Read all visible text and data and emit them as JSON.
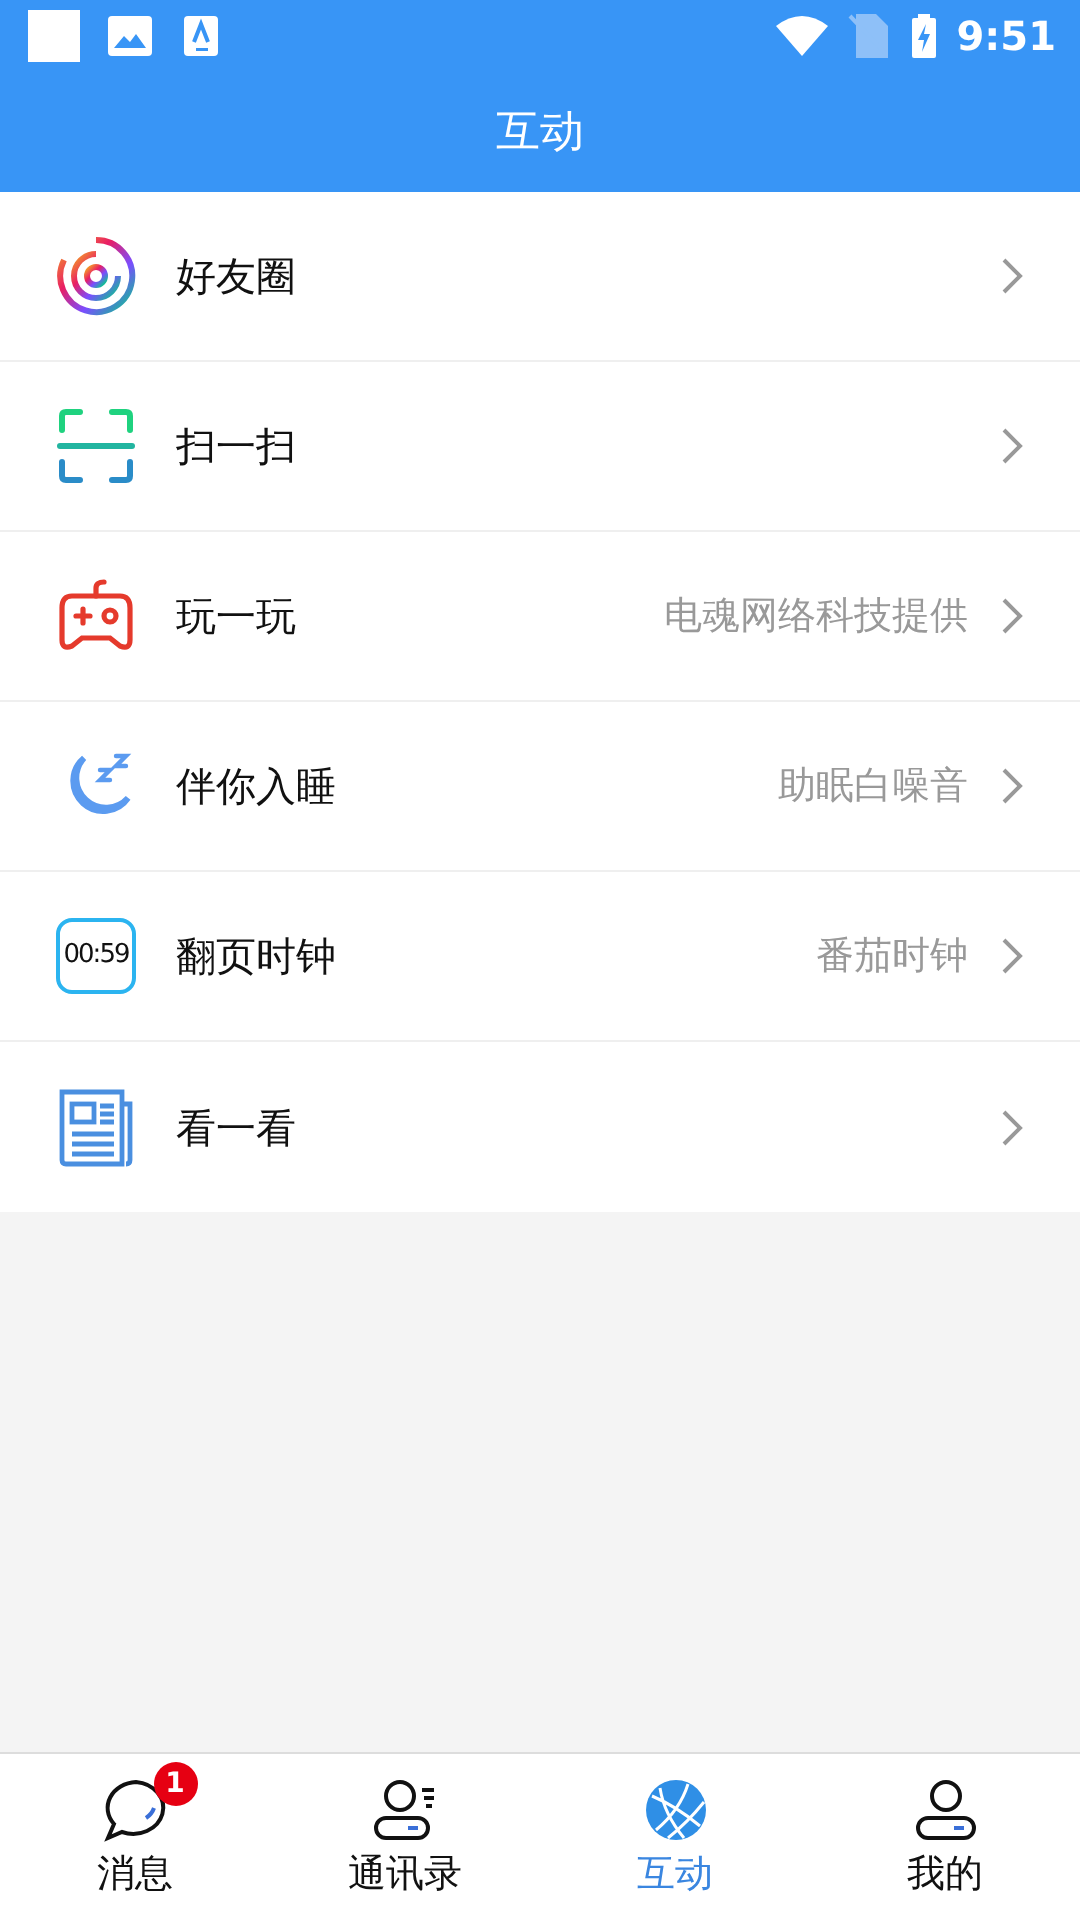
{
  "status_bar": {
    "time": "9:51"
  },
  "header": {
    "title": "互动"
  },
  "items": [
    {
      "kind": "moments",
      "label": "好友圈"
    },
    {
      "kind": "scan",
      "label": "扫一扫"
    },
    {
      "kind": "game",
      "label": "玩一玩",
      "note": "电魂网络科技提供"
    },
    {
      "kind": "sleep",
      "label": "伴你入睡",
      "note": "助眠白噪音"
    },
    {
      "kind": "clock",
      "label": "翻页时钟",
      "note": "番茄时钟",
      "icon_text": "00:59"
    },
    {
      "kind": "news",
      "label": "看一看"
    }
  ],
  "tabs": [
    {
      "kind": "chat",
      "label": "消息",
      "selected": false,
      "badge": "1"
    },
    {
      "kind": "contacts",
      "label": "通讯录",
      "selected": false
    },
    {
      "kind": "globe",
      "label": "互动",
      "selected": true
    },
    {
      "kind": "me",
      "label": "我的",
      "selected": false
    }
  ]
}
